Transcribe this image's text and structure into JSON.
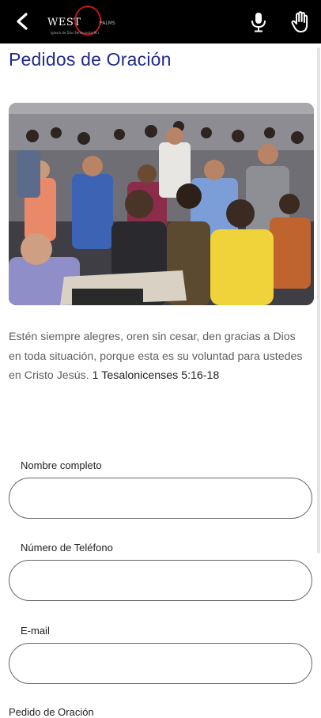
{
  "header": {
    "back_icon": "arrow-left-icon",
    "logo_word": "WEST",
    "logo_tag": "PALMS",
    "logo_sub": "Iglesia de Dios Pentecostal M.I.",
    "mic_icon": "microphone-icon",
    "hand_icon": "raised-hand-icon"
  },
  "page": {
    "title": "Pedidos de Oración"
  },
  "verse": {
    "text": "Estén siempre alegres, oren sin cesar, den gracias a Dios en toda situación, porque esta es su voluntad para ustedes en Cristo Jesús. ",
    "reference": "1 Tesalonicenses 5:16-18"
  },
  "form": {
    "name_label": "Nombre completo",
    "name_value": "",
    "phone_label": "Número de Teléfono",
    "phone_value": "",
    "email_label": "E-mail",
    "email_value": "",
    "request_label": "Pedido de Oración"
  },
  "colors": {
    "title": "#1f2a8c",
    "topbar": "#000000",
    "logo_accent": "#c0161c"
  }
}
